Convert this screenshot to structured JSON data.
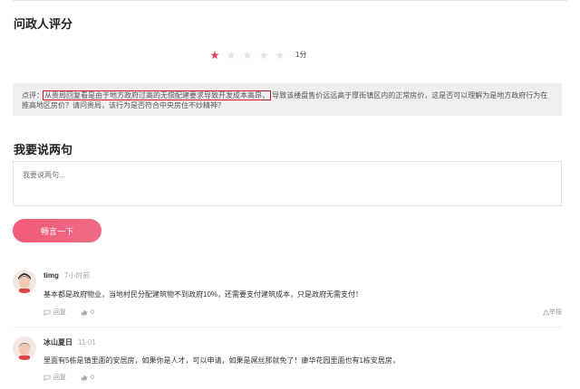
{
  "rating": {
    "title": "问政人评分",
    "stars_filled": 1,
    "stars_total": 5,
    "score_label": "1分"
  },
  "remark": {
    "prefix": "点评：",
    "highlighted": "从贵局回复看是由于地方政府过高的无偿配建要求导致开发成本高昂，",
    "rest": "导致该楼盘售价远远高于厚街镇区内的正常房价，这是否可以理解为是地方政府行为在推高地区房价？请问贵局，该行为是否符合中央房住不炒精神？"
  },
  "compose": {
    "title": "我要说两句",
    "placeholder": "我要说两句...",
    "submit_label": "畅言一下"
  },
  "comments": [
    {
      "user": "timg",
      "time": "7小时前",
      "text": "基本都是政府物业，当地村民分配建筑物不到政府10%，还需要支付建筑成本，只是政府无需支付！",
      "reply_label": "回复",
      "likes": "0",
      "report_label": "举报"
    },
    {
      "user": "冰山夏日",
      "time": "11-01",
      "text": "里面有5栋是镇里面的安居房，如果你是人才，可以申请，如果是屌丝那就免了！康华花园里面也有1栋安居房，",
      "reply_label": "回复",
      "likes": "0"
    }
  ],
  "colors": {
    "accent": "#ee5f7f",
    "star_filled": "#e8415f",
    "star_empty": "#e6e6e6",
    "highlight_box": "#d0191c"
  }
}
